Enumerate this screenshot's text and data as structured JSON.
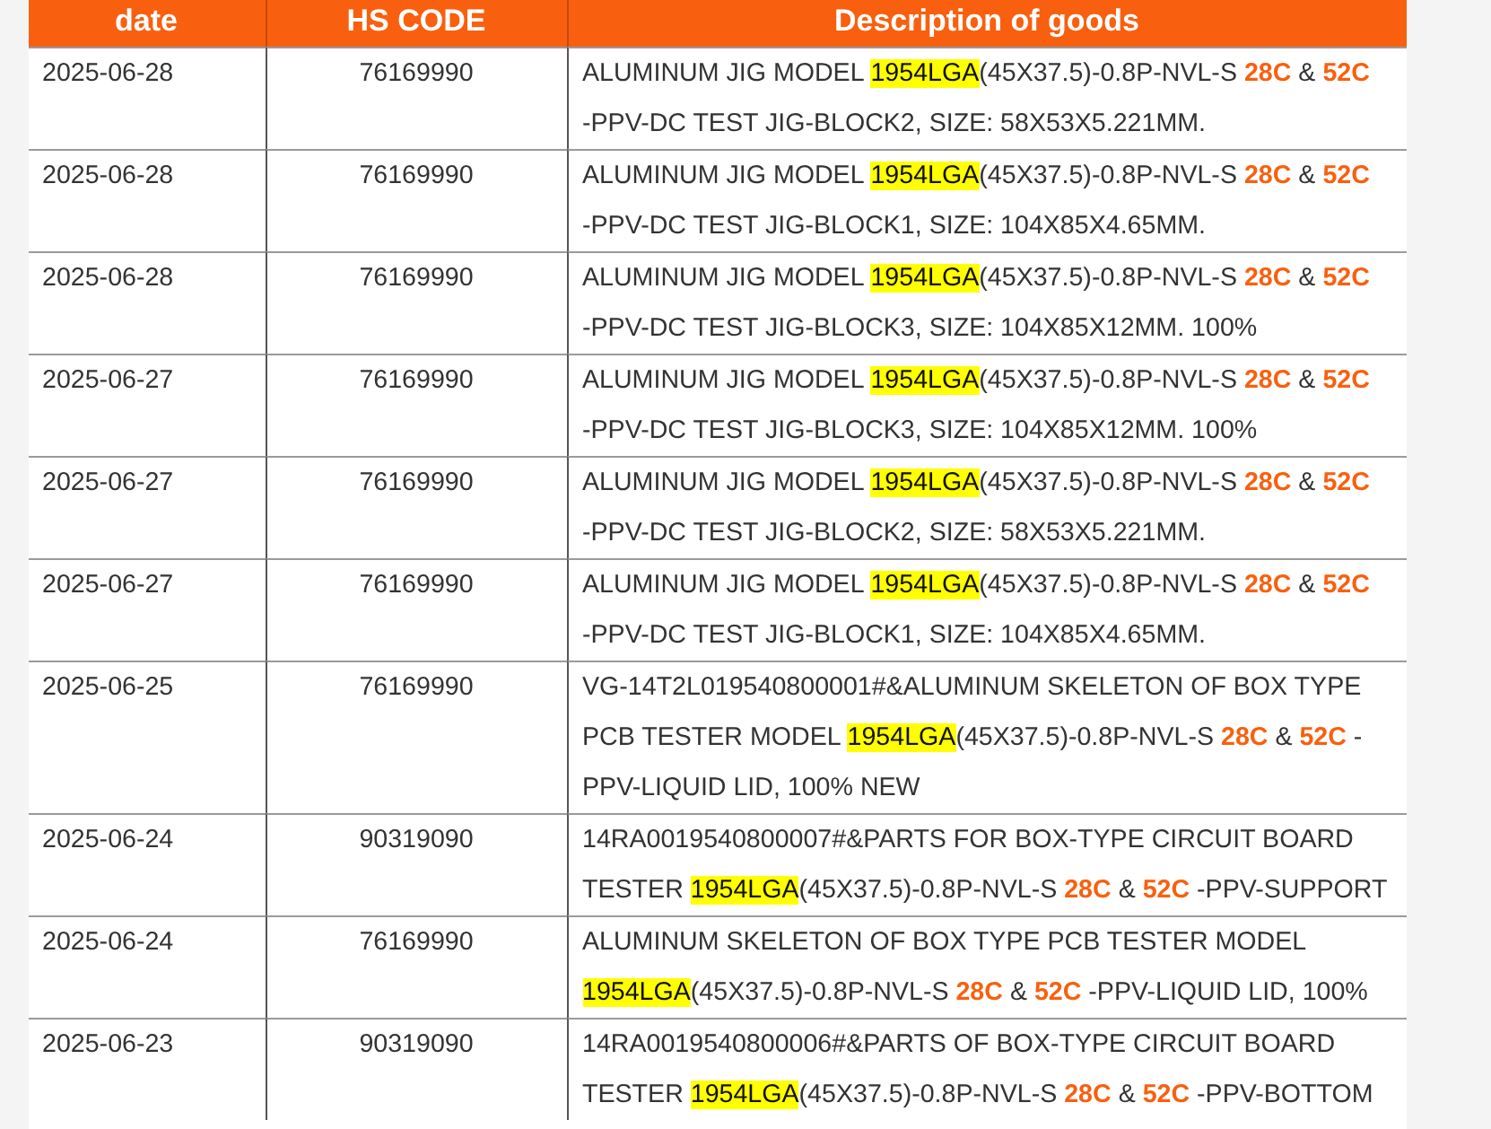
{
  "table": {
    "columns": [
      "date",
      "HS CODE",
      "Description of goods"
    ],
    "rows": [
      {
        "date": "2025-06-28",
        "hs_code": "76169990",
        "description": [
          [
            {
              "kind": "text",
              "text": "ALUMINUM JIG MODEL "
            },
            {
              "kind": "highlight",
              "text": "1954LGA"
            },
            {
              "kind": "text",
              "text": "(45X37.5)-0.8P-NVL-S "
            },
            {
              "kind": "emphasis",
              "text": "28C"
            },
            {
              "kind": "text",
              "text": " & "
            },
            {
              "kind": "emphasis",
              "text": "52C"
            }
          ],
          [
            {
              "kind": "text",
              "text": "-PPV-DC TEST JIG-BLOCK2, SIZE: 58X53X5.221MM."
            }
          ]
        ]
      },
      {
        "date": "2025-06-28",
        "hs_code": "76169990",
        "description": [
          [
            {
              "kind": "text",
              "text": "ALUMINUM JIG MODEL "
            },
            {
              "kind": "highlight",
              "text": "1954LGA"
            },
            {
              "kind": "text",
              "text": "(45X37.5)-0.8P-NVL-S "
            },
            {
              "kind": "emphasis",
              "text": "28C"
            },
            {
              "kind": "text",
              "text": " & "
            },
            {
              "kind": "emphasis",
              "text": "52C"
            }
          ],
          [
            {
              "kind": "text",
              "text": "-PPV-DC TEST JIG-BLOCK1, SIZE: 104X85X4.65MM."
            }
          ]
        ]
      },
      {
        "date": "2025-06-28",
        "hs_code": "76169990",
        "description": [
          [
            {
              "kind": "text",
              "text": "ALUMINUM JIG MODEL "
            },
            {
              "kind": "highlight",
              "text": "1954LGA"
            },
            {
              "kind": "text",
              "text": "(45X37.5)-0.8P-NVL-S "
            },
            {
              "kind": "emphasis",
              "text": "28C"
            },
            {
              "kind": "text",
              "text": " & "
            },
            {
              "kind": "emphasis",
              "text": "52C"
            }
          ],
          [
            {
              "kind": "text",
              "text": "-PPV-DC TEST JIG-BLOCK3, SIZE: 104X85X12MM. 100%"
            }
          ]
        ]
      },
      {
        "date": "2025-06-27",
        "hs_code": "76169990",
        "description": [
          [
            {
              "kind": "text",
              "text": "ALUMINUM JIG MODEL "
            },
            {
              "kind": "highlight",
              "text": "1954LGA"
            },
            {
              "kind": "text",
              "text": "(45X37.5)-0.8P-NVL-S "
            },
            {
              "kind": "emphasis",
              "text": "28C"
            },
            {
              "kind": "text",
              "text": " & "
            },
            {
              "kind": "emphasis",
              "text": "52C"
            }
          ],
          [
            {
              "kind": "text",
              "text": "-PPV-DC TEST JIG-BLOCK3, SIZE: 104X85X12MM. 100%"
            }
          ]
        ]
      },
      {
        "date": "2025-06-27",
        "hs_code": "76169990",
        "description": [
          [
            {
              "kind": "text",
              "text": "ALUMINUM JIG MODEL "
            },
            {
              "kind": "highlight",
              "text": "1954LGA"
            },
            {
              "kind": "text",
              "text": "(45X37.5)-0.8P-NVL-S "
            },
            {
              "kind": "emphasis",
              "text": "28C"
            },
            {
              "kind": "text",
              "text": " & "
            },
            {
              "kind": "emphasis",
              "text": "52C"
            }
          ],
          [
            {
              "kind": "text",
              "text": "-PPV-DC TEST JIG-BLOCK2, SIZE: 58X53X5.221MM."
            }
          ]
        ]
      },
      {
        "date": "2025-06-27",
        "hs_code": "76169990",
        "description": [
          [
            {
              "kind": "text",
              "text": "ALUMINUM JIG MODEL "
            },
            {
              "kind": "highlight",
              "text": "1954LGA"
            },
            {
              "kind": "text",
              "text": "(45X37.5)-0.8P-NVL-S "
            },
            {
              "kind": "emphasis",
              "text": "28C"
            },
            {
              "kind": "text",
              "text": " & "
            },
            {
              "kind": "emphasis",
              "text": "52C"
            }
          ],
          [
            {
              "kind": "text",
              "text": "-PPV-DC TEST JIG-BLOCK1, SIZE: 104X85X4.65MM."
            }
          ]
        ]
      },
      {
        "date": "2025-06-25",
        "hs_code": "76169990",
        "description": [
          [
            {
              "kind": "text",
              "text": "VG-14T2L019540800001#&ALUMINUM SKELETON OF BOX TYPE"
            }
          ],
          [
            {
              "kind": "text",
              "text": "PCB TESTER MODEL "
            },
            {
              "kind": "highlight",
              "text": "1954LGA"
            },
            {
              "kind": "text",
              "text": "(45X37.5)-0.8P-NVL-S "
            },
            {
              "kind": "emphasis",
              "text": "28C"
            },
            {
              "kind": "text",
              "text": " & "
            },
            {
              "kind": "emphasis",
              "text": "52C"
            },
            {
              "kind": "text",
              "text": " -"
            }
          ],
          [
            {
              "kind": "text",
              "text": "PPV-LIQUID LID, 100% NEW"
            }
          ]
        ]
      },
      {
        "date": "2025-06-24",
        "hs_code": "90319090",
        "description": [
          [
            {
              "kind": "text",
              "text": "14RA0019540800007#&PARTS FOR BOX-TYPE CIRCUIT BOARD"
            }
          ],
          [
            {
              "kind": "text",
              "text": "TESTER "
            },
            {
              "kind": "highlight",
              "text": "1954LGA"
            },
            {
              "kind": "text",
              "text": "(45X37.5)-0.8P-NVL-S "
            },
            {
              "kind": "emphasis",
              "text": "28C"
            },
            {
              "kind": "text",
              "text": " & "
            },
            {
              "kind": "emphasis",
              "text": "52C"
            },
            {
              "kind": "text",
              "text": " -PPV-SUPPORT"
            }
          ]
        ]
      },
      {
        "date": "2025-06-24",
        "hs_code": "76169990",
        "description": [
          [
            {
              "kind": "text",
              "text": "ALUMINUM SKELETON OF BOX TYPE PCB TESTER MODEL"
            }
          ],
          [
            {
              "kind": "highlight",
              "text": "1954LGA"
            },
            {
              "kind": "text",
              "text": "(45X37.5)-0.8P-NVL-S "
            },
            {
              "kind": "emphasis",
              "text": "28C"
            },
            {
              "kind": "text",
              "text": " & "
            },
            {
              "kind": "emphasis",
              "text": "52C"
            },
            {
              "kind": "text",
              "text": " -PPV-LIQUID LID, 100%"
            }
          ]
        ]
      },
      {
        "date": "2025-06-23",
        "hs_code": "90319090",
        "description": [
          [
            {
              "kind": "text",
              "text": "14RA0019540800006#&PARTS OF BOX-TYPE CIRCUIT BOARD"
            }
          ],
          [
            {
              "kind": "text",
              "text": "TESTER "
            },
            {
              "kind": "highlight",
              "text": "1954LGA"
            },
            {
              "kind": "text",
              "text": "(45X37.5)-0.8P-NVL-S "
            },
            {
              "kind": "emphasis",
              "text": "28C"
            },
            {
              "kind": "text",
              "text": " & "
            },
            {
              "kind": "emphasis",
              "text": "52C"
            },
            {
              "kind": "text",
              "text": " -PPV-BOTTOM"
            }
          ]
        ]
      }
    ]
  }
}
